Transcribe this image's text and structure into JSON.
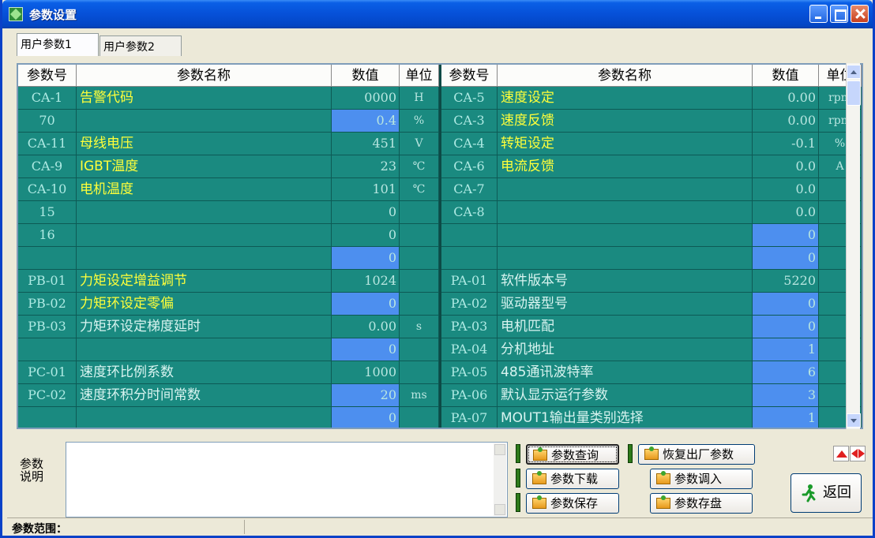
{
  "window": {
    "title": "参数设置"
  },
  "tabs": [
    "用户参数1",
    "用户参数2"
  ],
  "table": {
    "headers": [
      "参数号",
      "参数名称",
      "数值",
      "单位",
      "参数号",
      "参数名称",
      "数值",
      "单位"
    ],
    "left_rows": [
      {
        "id": "CA-1",
        "name": "告警代码",
        "value": "0000",
        "unit": "H",
        "value_blue": false,
        "name_plain": false
      },
      {
        "id": "70",
        "name": "",
        "value": "0.4",
        "unit": "%",
        "value_blue": true,
        "name_plain": false
      },
      {
        "id": "CA-11",
        "name": "母线电压",
        "value": "451",
        "unit": "V",
        "value_blue": false,
        "name_plain": false
      },
      {
        "id": "CA-9",
        "name": "IGBT温度",
        "value": "23",
        "unit": "℃",
        "value_blue": false,
        "name_plain": false
      },
      {
        "id": "CA-10",
        "name": "电机温度",
        "value": "101",
        "unit": "℃",
        "value_blue": false,
        "name_plain": false
      },
      {
        "id": "15",
        "name": "",
        "value": "0",
        "unit": "",
        "value_blue": false,
        "name_plain": false
      },
      {
        "id": "16",
        "name": "",
        "value": "0",
        "unit": "",
        "value_blue": false,
        "name_plain": false
      },
      {
        "id": "",
        "name": "",
        "value": "0",
        "unit": "",
        "value_blue": true,
        "name_plain": false
      },
      {
        "id": "PB-01",
        "name": "力矩设定增益调节",
        "value": "1024",
        "unit": "",
        "value_blue": false,
        "name_plain": false
      },
      {
        "id": "PB-02",
        "name": "力矩环设定零偏",
        "value": "0",
        "unit": "",
        "value_blue": true,
        "name_plain": false
      },
      {
        "id": "PB-03",
        "name": "力矩环设定梯度延时",
        "value": "0.00",
        "unit": "s",
        "value_blue": false,
        "name_plain": true
      },
      {
        "id": "",
        "name": "",
        "value": "0",
        "unit": "",
        "value_blue": true,
        "name_plain": false
      },
      {
        "id": "PC-01",
        "name": "速度环比例系数",
        "value": "1000",
        "unit": "",
        "value_blue": false,
        "name_plain": true
      },
      {
        "id": "PC-02",
        "name": "速度环积分时间常数",
        "value": "20",
        "unit": "ms",
        "value_blue": true,
        "name_plain": true
      },
      {
        "id": "",
        "name": "",
        "value": "0",
        "unit": "",
        "value_blue": true,
        "name_plain": false
      }
    ],
    "right_rows": [
      {
        "id": "CA-5",
        "name": "速度设定",
        "value": "0.00",
        "unit": "rpm",
        "value_blue": false,
        "name_plain": false
      },
      {
        "id": "CA-3",
        "name": "速度反馈",
        "value": "0.00",
        "unit": "rpm",
        "value_blue": false,
        "name_plain": false
      },
      {
        "id": "CA-4",
        "name": "转矩设定",
        "value": "-0.1",
        "unit": "%",
        "value_blue": false,
        "name_plain": false
      },
      {
        "id": "CA-6",
        "name": "电流反馈",
        "value": "0.0",
        "unit": "A",
        "value_blue": false,
        "name_plain": false
      },
      {
        "id": "CA-7",
        "name": "",
        "value": "0.0",
        "unit": "",
        "value_blue": false,
        "name_plain": false
      },
      {
        "id": "CA-8",
        "name": "",
        "value": "0.0",
        "unit": "",
        "value_blue": false,
        "name_plain": false
      },
      {
        "id": "",
        "name": "",
        "value": "0",
        "unit": "",
        "value_blue": true,
        "name_plain": false
      },
      {
        "id": "",
        "name": "",
        "value": "0",
        "unit": "",
        "value_blue": true,
        "name_plain": false
      },
      {
        "id": "PA-01",
        "name": "软件版本号",
        "value": "5220",
        "unit": "",
        "value_blue": false,
        "name_plain": true
      },
      {
        "id": "PA-02",
        "name": "驱动器型号",
        "value": "0",
        "unit": "",
        "value_blue": true,
        "name_plain": true
      },
      {
        "id": "PA-03",
        "name": "电机匹配",
        "value": "0",
        "unit": "",
        "value_blue": true,
        "name_plain": true
      },
      {
        "id": "PA-04",
        "name": "分机地址",
        "value": "1",
        "unit": "",
        "value_blue": true,
        "name_plain": true
      },
      {
        "id": "PA-05",
        "name": "485通讯波特率",
        "value": "6",
        "unit": "",
        "value_blue": true,
        "name_plain": true
      },
      {
        "id": "PA-06",
        "name": "默认显示运行参数",
        "value": "3",
        "unit": "",
        "value_blue": true,
        "name_plain": true
      },
      {
        "id": "PA-07",
        "name": "MOUT1输出量类别选择",
        "value": "1",
        "unit": "",
        "value_blue": true,
        "name_plain": true
      }
    ]
  },
  "description": {
    "label": "参数说明",
    "text": ""
  },
  "buttons": {
    "query": "参数查询",
    "restore": "恢复出厂参数",
    "download": "参数下载",
    "load": "参数调入",
    "save": "参数保存",
    "store": "参数存盘",
    "back": "返回"
  },
  "status": {
    "range_label": "参数范围："
  },
  "colors": {
    "cell_bg": "#1a8a80",
    "value_blue": "#4d8fef",
    "name_yellow": "#ffff3a"
  }
}
